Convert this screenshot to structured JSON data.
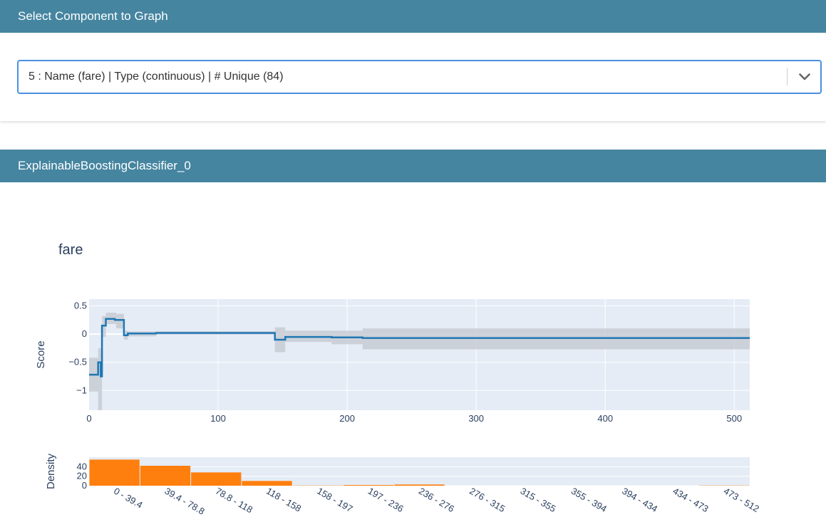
{
  "selector": {
    "header": "Select Component to Graph",
    "selected": "5 : Name (fare) | Type (continuous) | # Unique (84)",
    "icon": "chevron-down-icon"
  },
  "model_panel": {
    "header": "ExplainableBoostingClassifier_0"
  },
  "colors": {
    "header_bg": "#4585a0",
    "select_border": "#4a90e2",
    "score_line": "#1f77b4",
    "ci_band": "#c8cdd4",
    "density_bar": "#ff7f0e",
    "plot_bg": "#e5ecf6"
  },
  "chart_data": [
    {
      "type": "line",
      "title": "fare",
      "xlabel": "",
      "ylabel": "Score",
      "xlim": [
        0,
        512
      ],
      "ylim": [
        -1.35,
        0.62
      ],
      "x_ticks": [
        "0",
        "100",
        "200",
        "300",
        "400",
        "500"
      ],
      "y_ticks": [
        "0.5",
        "0",
        "−0.5",
        "−1"
      ],
      "grid": true,
      "series": [
        {
          "values": [
            [
              0,
              -0.72
            ],
            [
              7,
              -0.72
            ],
            [
              7,
              -0.5
            ],
            [
              9,
              -0.5
            ],
            [
              9,
              -0.75
            ],
            [
              10,
              -0.75
            ],
            [
              10,
              0.15
            ],
            [
              13,
              0.15
            ],
            [
              13,
              0.27
            ],
            [
              20,
              0.27
            ],
            [
              20,
              0.25
            ],
            [
              27,
              0.25
            ],
            [
              27,
              -0.02
            ],
            [
              30,
              -0.02
            ],
            [
              30,
              0.01
            ],
            [
              52,
              0.01
            ],
            [
              52,
              0.02
            ],
            [
              144,
              0.02
            ],
            [
              144,
              -0.1
            ],
            [
              152,
              -0.1
            ],
            [
              152,
              -0.05
            ],
            [
              188,
              -0.05
            ],
            [
              188,
              -0.06
            ],
            [
              212,
              -0.06
            ],
            [
              212,
              -0.07
            ],
            [
              512,
              -0.07
            ]
          ]
        }
      ],
      "confidence_band": [
        {
          "x": [
            0,
            7
          ],
          "lower": -1.02,
          "upper": -0.42
        },
        {
          "x": [
            7,
            10
          ],
          "lower": -1.35,
          "upper": -0.25
        },
        {
          "x": [
            10,
            13
          ],
          "lower": -0.05,
          "upper": 0.32
        },
        {
          "x": [
            13,
            21
          ],
          "lower": 0.18,
          "upper": 0.38
        },
        {
          "x": [
            21,
            27
          ],
          "lower": 0.1,
          "upper": 0.36
        },
        {
          "x": [
            27,
            30
          ],
          "lower": -0.1,
          "upper": 0.06
        },
        {
          "x": [
            30,
            52
          ],
          "lower": -0.04,
          "upper": 0.05
        },
        {
          "x": [
            52,
            144
          ],
          "lower": -0.01,
          "upper": 0.05
        },
        {
          "x": [
            144,
            152
          ],
          "lower": -0.32,
          "upper": 0.12
        },
        {
          "x": [
            152,
            188
          ],
          "lower": -0.14,
          "upper": 0.06
        },
        {
          "x": [
            188,
            212
          ],
          "lower": -0.18,
          "upper": 0.06
        },
        {
          "x": [
            212,
            512
          ],
          "lower": -0.27,
          "upper": 0.1
        }
      ]
    },
    {
      "type": "bar",
      "ylabel": "Density",
      "categories": [
        "0 - 39.4",
        "39.4 - 78.8",
        "78.8 - 118",
        "118 - 158",
        "158 - 197",
        "197 - 236",
        "236 - 276",
        "276 - 315",
        "315 - 355",
        "355 - 394",
        "394 - 434",
        "434 - 473",
        "473 - 512"
      ],
      "values": [
        55,
        42,
        28,
        10,
        0.5,
        1.5,
        2.5,
        0,
        0,
        0,
        0,
        0,
        0.5
      ],
      "ylim": [
        0,
        60
      ],
      "y_ticks": [
        "40",
        "20",
        "0"
      ],
      "grid": true
    }
  ]
}
